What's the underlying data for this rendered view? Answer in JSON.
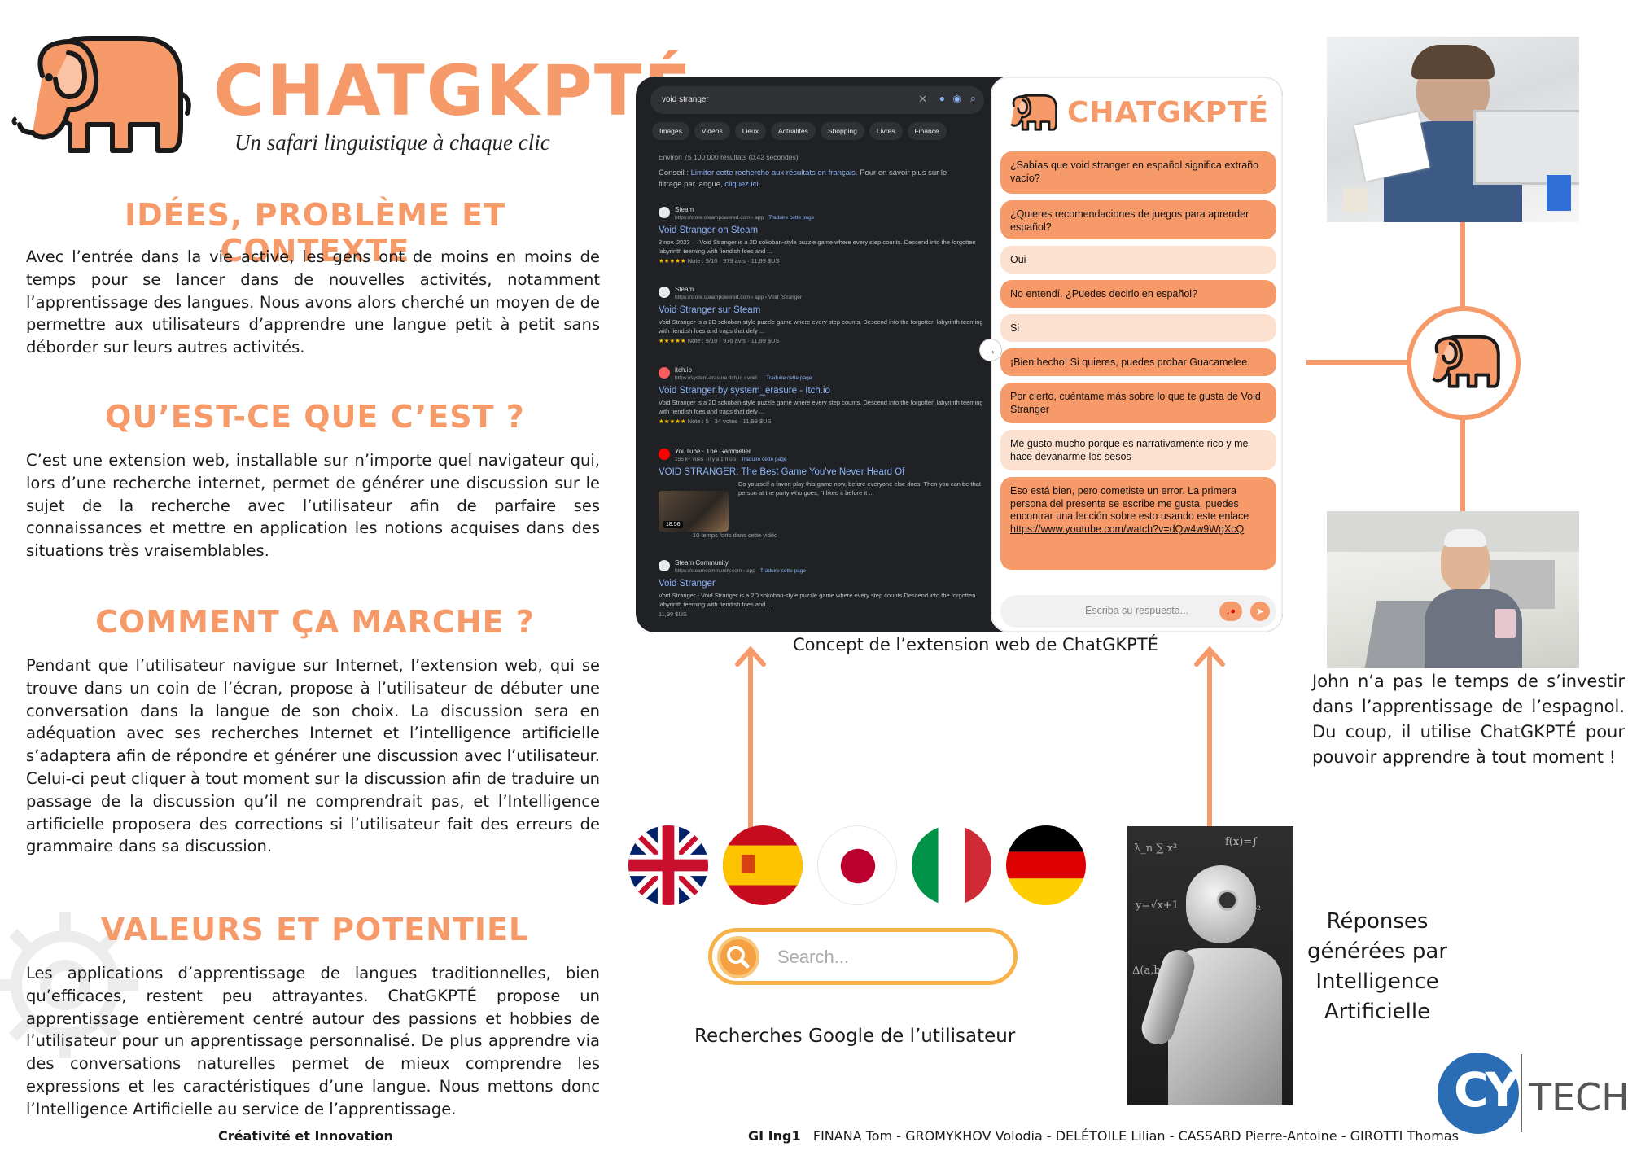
{
  "header": {
    "title": "CHATGKPTÉ",
    "subtitle": "Un safari linguistique à chaque clic"
  },
  "sections": [
    {
      "heading": "IDÉES, PROBLÈME ET CONTEXTE",
      "text": "Avec l’entrée dans la vie active, les gens ont de moins en moins de temps pour se lancer dans de nouvelles activités, notamment l’apprentissage des langues. Nous avons alors cherché un moyen de de permettre aux utilisateurs d’apprendre une langue petit à petit sans déborder sur leurs autres activités."
    },
    {
      "heading": "QU’EST-CE QUE C’EST ?",
      "text": "C’est une extension web, installable sur n’importe quel navigateur qui, lors d’une recherche internet, permet de générer une discussion sur le sujet de la recherche avec l’utilisateur afin de parfaire ses connaissances et mettre en application les notions acquises dans des situations très vraisemblables."
    },
    {
      "heading": "COMMENT ÇA MARCHE ?",
      "text": "Pendant que l’utilisateur navigue sur Internet, l’extension web, qui se trouve dans un coin de l’écran, propose à l’utilisateur de débuter une conversation dans la langue de son choix. La discussion sera en adéquation avec ses recherches Internet et l’intelligence artificielle s’adaptera afin de répondre et générer une discussion avec l’utilisateur. Celui-ci peut cliquer à tout moment sur la discussion afin de traduire un passage de la discussion qu’il ne comprendrait pas, et l’Intelligence artificielle proposera des corrections si l’utilisateur fait des erreurs de grammaire dans sa discussion."
    },
    {
      "heading": "VALEURS ET POTENTIEL",
      "text": "Les applications d’apprentissage de langues traditionnelles, bien qu’efficaces, restent peu attrayantes. ChatGKPTÉ propose un apprentissage entièrement centré autour des passions et hobbies de l’utilisateur pour un apprentissage personnalisé. De plus apprendre via des conversations naturelles permet de mieux comprendre les expressions et les caractéristiques d’une langue. Nous mettons donc l’Intelligence Artificielle au service de l’apprentissage."
    }
  ],
  "browser": {
    "query": "void stranger",
    "tabs": [
      "Images",
      "Vidéos",
      "Lieux",
      "Actualités",
      "Shopping",
      "Livres",
      "Finance"
    ],
    "stats": "Environ 75 100 000 résultats (0,42 secondes)",
    "tip_prefix": "Conseil : ",
    "tip_link": "Limiter cette recherche aux résultats en français",
    "tip_suffix": ". Pour en savoir plus sur le filtrage par langue, ",
    "tip_link2": "cliquez ici",
    "results": [
      {
        "site": "Steam",
        "url": "https://store.steampowered.com › app",
        "translate": "Traduire cette page",
        "title": "Void Stranger on Steam",
        "desc": "3 nov. 2023 — Void Stranger is a 2D sokoban-style puzzle game where every step counts. Descend into the forgotten labyrinth teeming with fiendish foes and ...",
        "rating": "Note : 9/10 · 979 avis · 11,99 $US"
      },
      {
        "site": "Steam",
        "url": "https://store.steampowered.com › app › Void_Stranger",
        "translate": "",
        "title": "Void Stranger sur Steam",
        "desc": "Void Stranger is a 2D sokoban-style puzzle game where every step counts. Descend into the forgotten labyrinth teeming with fiendish foes and traps that defy ...",
        "rating": "Note : 9/10 · 976 avis · 11,99 $US"
      },
      {
        "site": "itch.io",
        "url": "https://system-erasure.itch.io › void...",
        "translate": "Traduire cette page",
        "title": "Void Stranger by system_erasure - Itch.io",
        "desc": "Void Stranger is a 2D sokoban-style puzzle game where every step counts. Descend into the forgotten labyrinth teeming with fiendish foes and traps that defy ...",
        "rating": "Note : 5 · 34 votes · 11,99 $US"
      },
      {
        "site": "YouTube · The Gammelier",
        "url": "155 k+ vues · il y a 1 mois",
        "translate": "Traduire cette page",
        "title": "VOID STRANGER: The Best Game You've Never Heard Of",
        "desc": "Do yourself a favor: play this game now, before everyone else does. Then you can be that person at the party who goes, \"I liked it before it ...",
        "rating": "10 temps forts dans cette vidéo"
      },
      {
        "site": "Steam Community",
        "url": "https://steamcommunity.com › app",
        "translate": "Traduire cette page",
        "title": "Void Stranger",
        "desc": "Void Stranger - Void Stranger is a 2D sokoban-style puzzle game where every step counts.Descend into the forgotten labyrinth teeming with fiendish foes and ...",
        "rating": "11,99 $US"
      }
    ],
    "video_duration": "18:56",
    "stars": "★★★★★"
  },
  "chat": {
    "title": "CHATGKPTÉ",
    "messages": [
      {
        "text": "¿Sabías que void stranger en español significa extraño vacío?",
        "from": "bot"
      },
      {
        "text": "¿Quieres recomendaciones de juegos para aprender español?",
        "from": "bot"
      },
      {
        "text": "Oui",
        "from": "user"
      },
      {
        "text": "No entendí. ¿Puedes decirlo en español?",
        "from": "bot"
      },
      {
        "text": "Si",
        "from": "user"
      },
      {
        "text": "¡Bien hecho! Si quieres, puedes probar Guacamelee.",
        "from": "bot"
      },
      {
        "text": "Por cierto, cuéntame más sobre lo que te gusta de Void Stranger",
        "from": "bot"
      },
      {
        "text": "Me gusto mucho porque es narrativamente rico y me hace devanarme los sesos",
        "from": "user"
      },
      {
        "text": "Eso está bien, pero cometiste un error. La primera persona del presente se escribe me gusta, puedes encontrar una lección sobre esto usando este enlace",
        "from": "bot",
        "link": "https://www.youtube.com/watch?v=dQw4w9WgXcQ"
      }
    ],
    "input_placeholder": "Escriba su respuesta..."
  },
  "captions": {
    "extension": "Concept de l’extension web de ChatGKPTÉ",
    "google": "Recherches Google de l’utilisateur",
    "search_placeholder": "Search...",
    "ai": "Réponses générées par Intelligence Artificielle",
    "john": "John n’a pas le temps de s’investir dans l’apprentissage de l’espagnol. Du coup, il utilise ChatGKPTÉ pour pouvoir apprendre à tout moment !"
  },
  "flags": [
    "uk-flag",
    "spain-flag",
    "japan-flag",
    "italy-flag",
    "germany-flag"
  ],
  "footer": {
    "course": "Créativité et Innovation",
    "group": "GI Ing1",
    "authors": "FINANA Tom - GROMYKHOV Volodia - DELÉTOILE Lilian - CASSARD Pierre-Antoine - GIROTTI Thomas",
    "logo_cy": "CY",
    "logo_tech": "TECH"
  },
  "colors": {
    "accent": "#F79A6A",
    "accent_light": "#FCE1D1",
    "search_ring": "#F7B24A",
    "cy_blue": "#2A6DB5"
  }
}
